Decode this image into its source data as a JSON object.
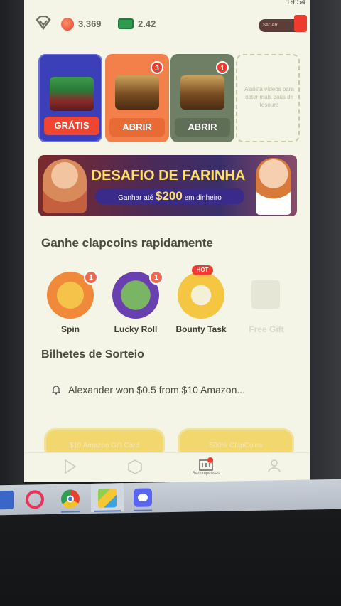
{
  "status": {
    "time": "19:54"
  },
  "topbar": {
    "coins": "3,369",
    "cash": "2.42",
    "withdraw_label": "SACAR"
  },
  "chests": [
    {
      "label": "GRÁTIS",
      "badge": ""
    },
    {
      "label": "ABRIR",
      "badge": "3"
    },
    {
      "label": "ABRIR",
      "badge": "1"
    },
    {
      "label": "",
      "placeholder_text": "Assista vídeos para obter mais baús de tesouro"
    }
  ],
  "banner": {
    "title": "DESAFIO DE FARINHA",
    "subtitle_prefix": "Ganhar até",
    "amount": "$200",
    "subtitle_suffix": "em dinheiro"
  },
  "quick_section": {
    "title": "Ganhe clapcoins rapidamente",
    "items": [
      {
        "label": "Spin",
        "badge": "1",
        "icon": "spin-wheel-icon"
      },
      {
        "label": "Lucky Roll",
        "badge": "1",
        "icon": "lucky-roll-icon"
      },
      {
        "label": "Bounty Task",
        "tag": "HOT",
        "icon": "coin-stack-icon"
      },
      {
        "label": "Free Gift",
        "icon": "gift-icon"
      }
    ]
  },
  "tickets": {
    "title": "Bilhetes de Sorteio",
    "ticker": "Alexander won $0.5 from $10 Amazon..."
  },
  "bottom_buttons": [
    "$10 Amazon Gift Card",
    "500% ClapCoins"
  ],
  "nav": {
    "items": [
      {
        "label": "",
        "icon": "play-icon"
      },
      {
        "label": "",
        "icon": "cube-icon"
      },
      {
        "label": "Recompensas",
        "icon": "rewards-icon"
      },
      {
        "label": "",
        "icon": "profile-icon"
      }
    ]
  },
  "taskbar": {
    "apps": [
      "file-explorer-icon",
      "opera-icon",
      "chrome-icon",
      "bluestacks-icon",
      "discord-icon"
    ]
  },
  "colors": {
    "accent": "#ee3b2e",
    "chest1": "#3b3fb8",
    "chest2": "#f3804a",
    "chest3": "#6f7f66",
    "background": "#f4f5e6"
  }
}
